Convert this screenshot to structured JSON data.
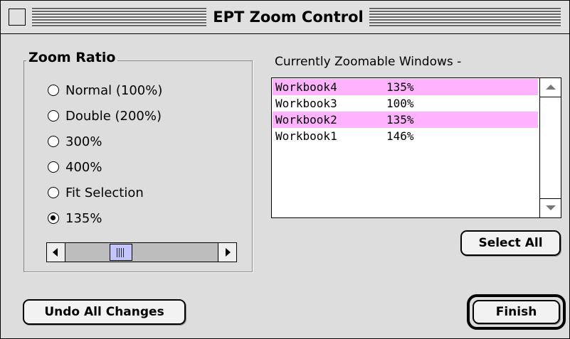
{
  "window": {
    "title": "EPT Zoom Control"
  },
  "zoom_ratio": {
    "title": "Zoom Ratio",
    "options": [
      {
        "label": "Normal (100%)",
        "selected": false
      },
      {
        "label": "Double (200%)",
        "selected": false
      },
      {
        "label": "300%",
        "selected": false
      },
      {
        "label": "400%",
        "selected": false
      },
      {
        "label": "Fit Selection",
        "selected": false
      },
      {
        "label": "135%",
        "selected": true
      }
    ],
    "slider": {
      "value_percent": 135
    }
  },
  "windows_list": {
    "caption": "Currently Zoomable Windows -",
    "items": [
      {
        "name": "Workbook4",
        "zoom": "135%",
        "selected": true
      },
      {
        "name": "Workbook3",
        "zoom": "100%",
        "selected": false
      },
      {
        "name": "Workbook2",
        "zoom": "135%",
        "selected": true
      },
      {
        "name": "Workbook1",
        "zoom": "146%",
        "selected": false
      }
    ],
    "highlight_color": "#ffb3ff"
  },
  "buttons": {
    "select_all": "Select All",
    "undo_all": "Undo All Changes",
    "finish": "Finish"
  }
}
